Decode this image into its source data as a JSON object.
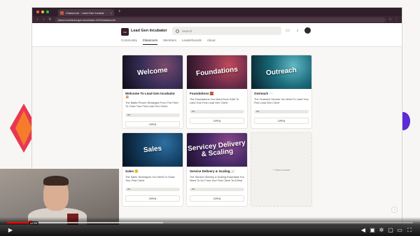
{
  "browser": {
    "tab_title": "Classroom · Lead Gen Incubat",
    "tab_close": "×",
    "new_tab": "+",
    "url": "skool.com/lead-gen-incubator-1015/classroom",
    "colors": {
      "chrome": "#2f1f2a",
      "close": "#ff5f57",
      "min": "#febc2e",
      "max": "#28c840"
    }
  },
  "header": {
    "logo": "LGI",
    "brand": "Lead Gen Incubator",
    "brand_caret": "⇕",
    "search_placeholder": "Search",
    "icons": [
      "chat-icon",
      "bell-icon",
      "avatar"
    ],
    "nav": [
      {
        "label": "Community",
        "active": false
      },
      {
        "label": "Classroom",
        "active": true
      },
      {
        "label": "Members",
        "active": false
      },
      {
        "label": "Leaderboards",
        "active": false
      },
      {
        "label": "About",
        "active": false
      }
    ]
  },
  "courses": [
    {
      "thumb_text": "Welcome",
      "thumb_colors": [
        "#0c0c14",
        "#3a2f5a",
        "#7a4a6a"
      ],
      "title": "Welcome To Lead Gen Incubator 🎉",
      "desc": "The Battle-Proven Strategies From The Field To Close Your First Lead Gen Client",
      "progress": 0,
      "progress_label": "0%",
      "button": "OPEN"
    },
    {
      "thumb_text": "Foundations",
      "thumb_colors": [
        "#1a0f1c",
        "#6a2a4a",
        "#c24a5a"
      ],
      "title": "Foundations 🧱",
      "desc": "The Foundations You Need Rock Solid To Land Your First Lead Gen Client",
      "progress": 0,
      "progress_label": "0%",
      "button": "OPEN"
    },
    {
      "thumb_text": "Outreach",
      "thumb_colors": [
        "#08202a",
        "#1a6a7a",
        "#62b8c4"
      ],
      "title": "Outreach 📨",
      "desc": "The Outreach Secrets You Need To Land Your First Lead Gen Client",
      "progress": 0,
      "progress_label": "0%",
      "button": "OPEN"
    },
    {
      "thumb_text": "Sales",
      "thumb_colors": [
        "#06121e",
        "#134064",
        "#2f6fa2"
      ],
      "title": "Sales 😊",
      "desc": "The Sales Techniques You Need To Close Your First Client",
      "progress": 0,
      "progress_label": "0%",
      "button": "OPEN"
    },
    {
      "thumb_text": "Servicey Delivery & Scaling",
      "thumb_colors": [
        "#1c0e2c",
        "#4a2a6a",
        "#8a4a8a"
      ],
      "title": "Service Delivery & Scaling 📈",
      "desc": "The Service Delivery & Scaling Essentials You Need To Go From Your First Client To A Real",
      "progress": 0,
      "progress_label": "0%",
      "button": "OPEN"
    }
  ],
  "new_course_label": "+ New course",
  "help_label": "?",
  "player": {
    "time": "02:25",
    "controls": [
      "play-icon",
      "next-icon",
      "volume-icon",
      "subtitles-icon",
      "settings-icon",
      "miniplayer-icon",
      "theater-icon",
      "fullscreen-icon"
    ],
    "accent": "#ff0000"
  }
}
